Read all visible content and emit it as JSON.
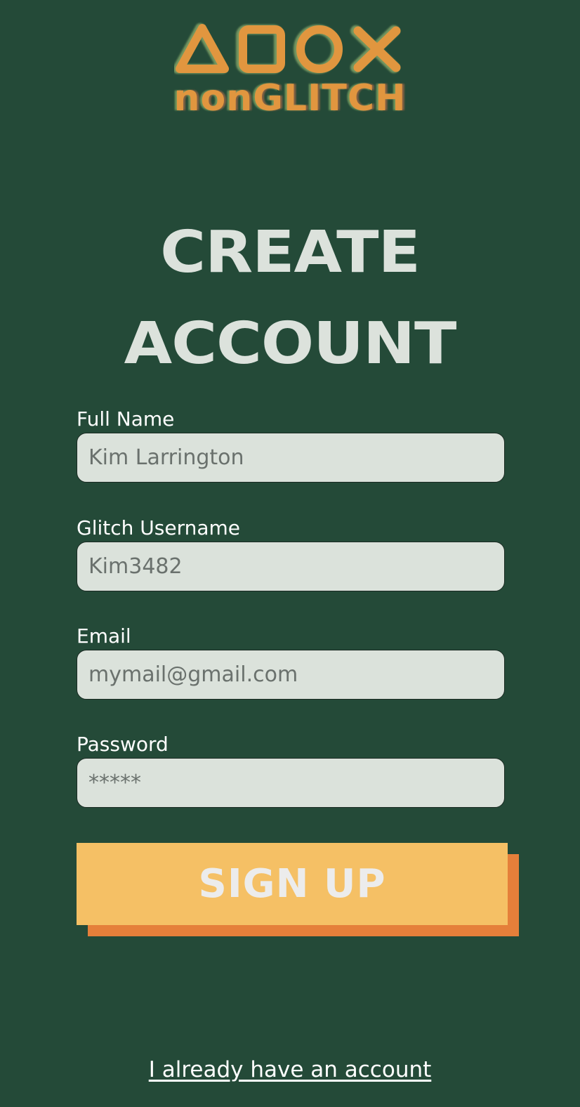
{
  "logo": {
    "symbols": [
      "triangle",
      "square",
      "circle",
      "cross"
    ],
    "wordmark": "nonGLITCH"
  },
  "title": {
    "line1": "CREATE",
    "line2": "ACCOUNT"
  },
  "form": {
    "full_name": {
      "label": "Full Name",
      "placeholder": "Kim Larrington"
    },
    "username": {
      "label": "Glitch Username",
      "placeholder": "Kim3482"
    },
    "email": {
      "label": "Email",
      "placeholder": "mymail@gmail.com"
    },
    "password": {
      "label": "Password",
      "placeholder": "*****"
    }
  },
  "signup_button": {
    "label": "SIGN UP"
  },
  "login_link": {
    "label": "I already have an account"
  },
  "colors": {
    "background": "#244a38",
    "accent_yellow": "#f5c065",
    "accent_orange": "#e57f3a",
    "input_bg": "#dbe2db",
    "logo_orange": "#e1963f"
  }
}
